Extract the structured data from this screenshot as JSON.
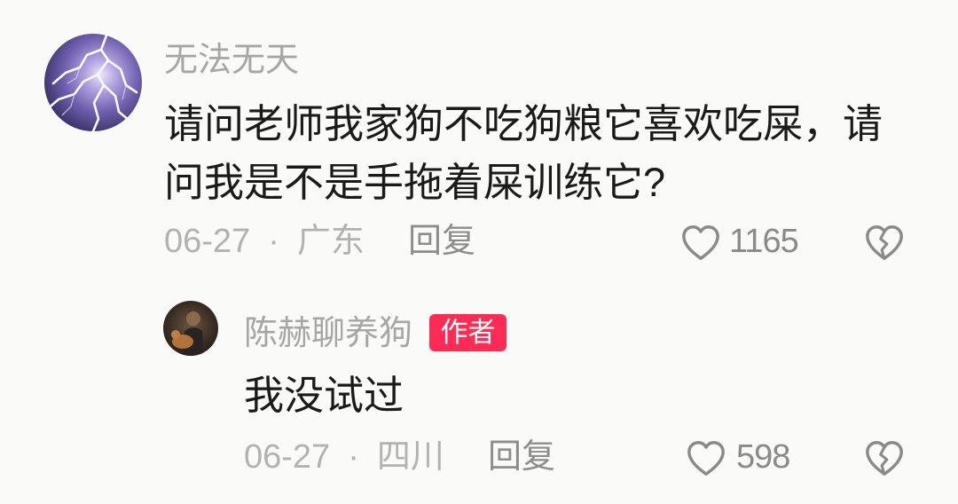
{
  "colors": {
    "background": "#fafaf8",
    "username": "#a6a6a6",
    "text": "#1a1a1a",
    "meta": "#b2b2b2",
    "action": "#8a8a8a",
    "reply_label": "#8d8d8d",
    "author_badge": "#fe2c55"
  },
  "icons": {
    "like": "heart-outline-icon",
    "dislike": "broken-heart-icon"
  },
  "comment": {
    "username": "无法无天",
    "text": "请问老师我家狗不吃狗粮它喜欢吃屎，请问我是不是手拖着屎训练它?",
    "date": "06-27",
    "separator": "·",
    "location": "广东",
    "reply_label": "回复",
    "likes": 1165
  },
  "reply": {
    "username": "陈赫聊养狗",
    "badge": "作者",
    "text": "我没试过",
    "date": "06-27",
    "separator": "·",
    "location": "四川",
    "reply_label": "回复",
    "likes": 598
  }
}
